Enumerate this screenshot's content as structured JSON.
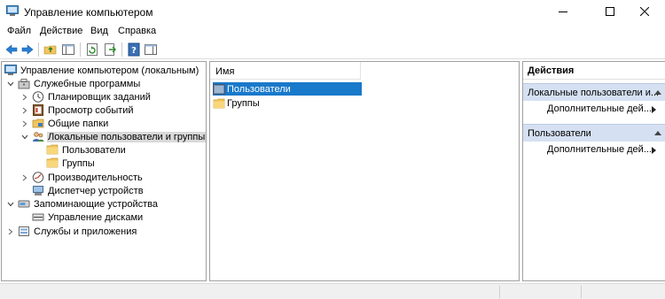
{
  "window": {
    "title": "Управление компьютером"
  },
  "menu": [
    "Файл",
    "Действие",
    "Вид",
    "Справка"
  ],
  "tree": [
    {
      "label": "Управление компьютером (локальным)",
      "icon": "computer-management-icon",
      "expanded": true,
      "level": 0
    },
    {
      "label": "Служебные программы",
      "icon": "tools-icon",
      "expanded": true,
      "level": 1
    },
    {
      "label": "Планировщик заданий",
      "icon": "clock-icon",
      "expanded": false,
      "level": 2
    },
    {
      "label": "Просмотр событий",
      "icon": "event-viewer-icon",
      "expanded": false,
      "level": 2
    },
    {
      "label": "Общие папки",
      "icon": "shared-folder-icon",
      "expanded": false,
      "level": 2
    },
    {
      "label": "Локальные пользователи и группы",
      "icon": "users-icon",
      "expanded": true,
      "level": 2,
      "selected": true
    },
    {
      "label": "Пользователи",
      "icon": "folder-icon",
      "level": 3
    },
    {
      "label": "Группы",
      "icon": "folder-icon",
      "level": 3
    },
    {
      "label": "Производительность",
      "icon": "performance-icon",
      "expanded": false,
      "level": 2
    },
    {
      "label": "Диспетчер устройств",
      "icon": "device-manager-icon",
      "level": 2
    },
    {
      "label": "Запоминающие устройства",
      "icon": "storage-icon",
      "expanded": true,
      "level": 1
    },
    {
      "label": "Управление дисками",
      "icon": "disk-icon",
      "level": 2
    },
    {
      "label": "Службы и приложения",
      "icon": "services-icon",
      "expanded": false,
      "level": 1
    }
  ],
  "list": {
    "column_header": "Имя",
    "items": [
      {
        "label": "Пользователи",
        "icon": "folder-icon",
        "selected": true
      },
      {
        "label": "Группы",
        "icon": "folder-icon",
        "selected": false
      }
    ]
  },
  "actions": {
    "title": "Действия",
    "sections": [
      {
        "header": "Локальные пользователи и группы",
        "items": [
          "Дополнительные действия"
        ]
      },
      {
        "header": "Пользователи",
        "items": [
          "Дополнительные действия"
        ]
      }
    ],
    "header_1_display": "Локальные пользователи и...",
    "item_display": "Дополнительные дей..."
  },
  "colors": {
    "selection": "#1979ca",
    "section_header": "#d5e1f2",
    "folder": "#f2c55c"
  }
}
